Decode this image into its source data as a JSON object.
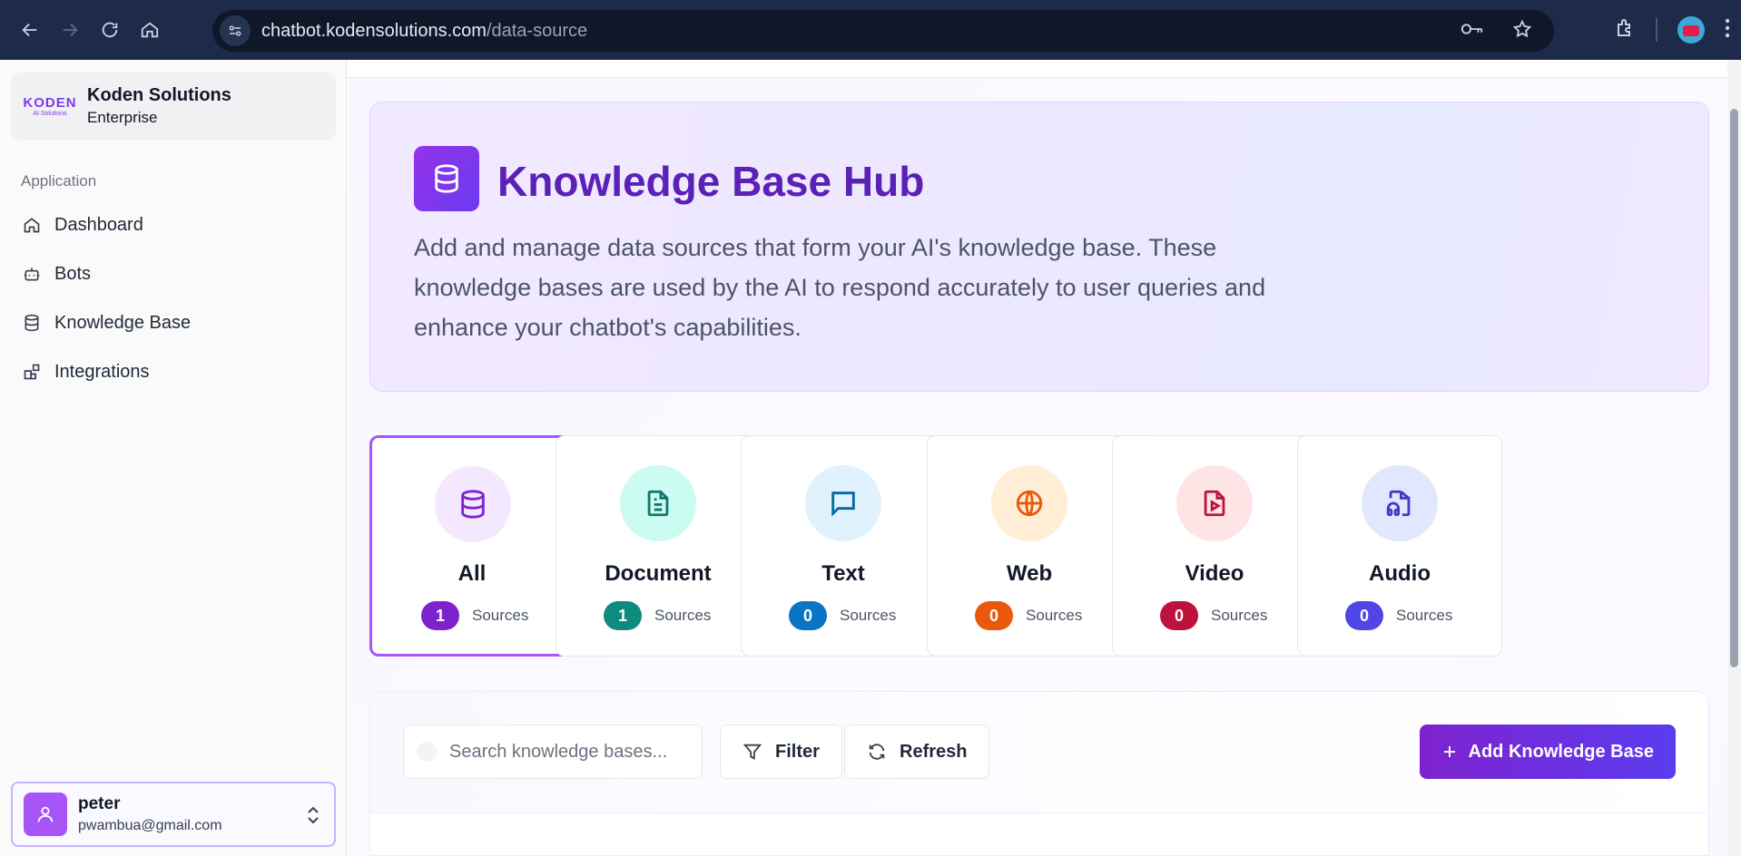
{
  "browser": {
    "url_host": "chatbot.kodensolutions.com",
    "url_path": "/data-source"
  },
  "sidebar": {
    "org": {
      "logo_text": "KODEN",
      "logo_sub": "AI Solutions",
      "name": "Koden Solutions",
      "plan": "Enterprise"
    },
    "section_label": "Application",
    "items": [
      {
        "label": "Dashboard",
        "icon": "home-icon"
      },
      {
        "label": "Bots",
        "icon": "bot-icon"
      },
      {
        "label": "Knowledge Base",
        "icon": "database-icon"
      },
      {
        "label": "Integrations",
        "icon": "blocks-icon"
      }
    ],
    "user": {
      "name": "peter",
      "email": "pwambua@gmail.com"
    }
  },
  "hero": {
    "title": "Knowledge Base Hub",
    "description": "Add and manage data sources that form your AI's knowledge base. These knowledge bases are used by the AI to respond accurately to user queries and enhance your chatbot's capabilities."
  },
  "categories": [
    {
      "title": "All",
      "count": "1",
      "sub": "Sources",
      "icon": "database-icon",
      "bg": "#f3e8ff",
      "fg": "#7e22ce",
      "badge": "#7e22ce"
    },
    {
      "title": "Document",
      "count": "1",
      "sub": "Sources",
      "icon": "document-icon",
      "bg": "#ccfbf1",
      "fg": "#0f766e",
      "badge": "#0f8a7e"
    },
    {
      "title": "Text",
      "count": "0",
      "sub": "Sources",
      "icon": "message-icon",
      "bg": "#e0f2fe",
      "fg": "#0369a1",
      "badge": "#0b74c4"
    },
    {
      "title": "Web",
      "count": "0",
      "sub": "Sources",
      "icon": "globe-icon",
      "bg": "#ffedd5",
      "fg": "#ea580c",
      "badge": "#ea580c"
    },
    {
      "title": "Video",
      "count": "0",
      "sub": "Sources",
      "icon": "video-file-icon",
      "bg": "#ffe4e6",
      "fg": "#be123c",
      "badge": "#be123c"
    },
    {
      "title": "Audio",
      "count": "0",
      "sub": "Sources",
      "icon": "audio-file-icon",
      "bg": "#e0e7ff",
      "fg": "#4338ca",
      "badge": "#4f46e5"
    }
  ],
  "toolbar": {
    "search_placeholder": "Search knowledge bases...",
    "filter_label": "Filter",
    "refresh_label": "Refresh",
    "add_label": "Add Knowledge Base"
  }
}
